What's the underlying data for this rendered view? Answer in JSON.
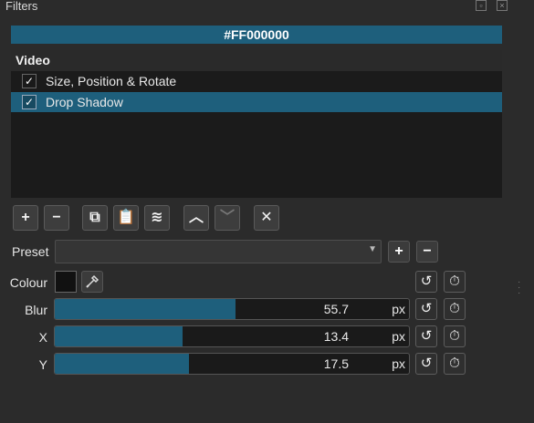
{
  "panel": {
    "title": "Filters"
  },
  "color_bar": {
    "text": "#FF000000"
  },
  "list": {
    "header": "Video",
    "items": [
      {
        "label": "Size, Position & Rotate",
        "checked": true
      },
      {
        "label": "Drop Shadow",
        "checked": true,
        "selected": true
      }
    ]
  },
  "toolbar": {
    "add": "+",
    "remove": "−",
    "copy": "⧉",
    "paste": "📋",
    "save": "≋",
    "move_up": "︿",
    "move_down": "﹀",
    "close": "✕"
  },
  "preset": {
    "label": "Preset",
    "value": "",
    "add": "+",
    "remove": "−"
  },
  "params": {
    "colour": {
      "label": "Colour",
      "value": "#111111"
    },
    "blur": {
      "label": "Blur",
      "value": "55.7",
      "unit": "px",
      "fill_fraction": 0.51
    },
    "x": {
      "label": "X",
      "value": "13.4",
      "unit": "px",
      "fill_fraction": 0.36
    },
    "y": {
      "label": "Y",
      "value": "17.5",
      "unit": "px",
      "fill_fraction": 0.38
    }
  },
  "icons": {
    "reset": "↺",
    "keyframe": "⏱"
  },
  "colors": {
    "accent": "#1e5f7c",
    "background": "#2b2b2b"
  }
}
